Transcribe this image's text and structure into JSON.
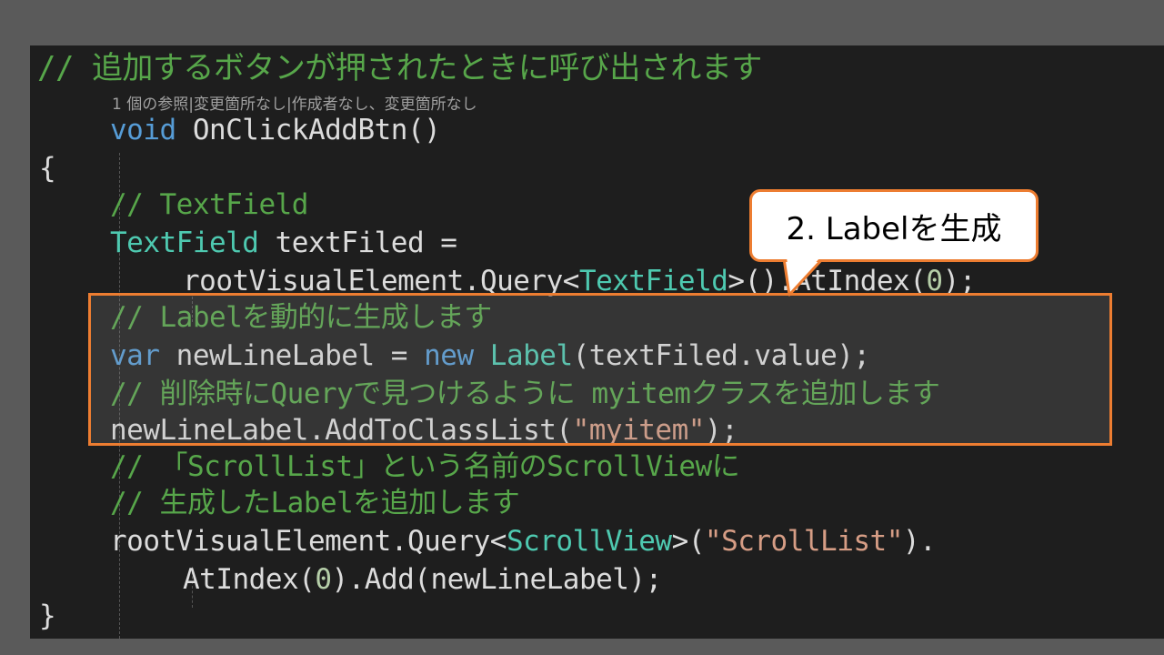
{
  "code": {
    "header_comment": "// 追加するボタンが押されたときに呼び出されます",
    "codelens": "1 個の参照|変更箇所なし|作成者なし、変更箇所なし",
    "lines": {
      "l1_kw": "void",
      "l1_rest": " OnClickAddBtn()",
      "l2": "{",
      "l3": "// TextField",
      "l4_type": "TextField",
      "l4_rest": " textFiled =",
      "l5_a": "rootVisualElement.Query<",
      "l5_type": "TextField",
      "l5_b": ">().AtIndex(",
      "l5_num": "0",
      "l5_c": ");",
      "l6": "// Labelを動的に生成します",
      "l7_kw1": "var",
      "l7_a": " newLineLabel = ",
      "l7_kw2": "new",
      "l7_sp": " ",
      "l7_type": "Label",
      "l7_b": "(textFiled.value);",
      "l8": "// 削除時にQueryで見つけるように myitemクラスを追加します",
      "l9_a": "newLineLabel.AddToClassList(",
      "l9_str": "\"myitem\"",
      "l9_b": ");",
      "l10": "// 「ScrollList」という名前のScrollViewに",
      "l11": "// 生成したLabelを追加します",
      "l12_a": "rootVisualElement.Query<",
      "l12_type": "ScrollView",
      "l12_b": ">(",
      "l12_str": "\"ScrollList\"",
      "l12_c": ").",
      "l13_a": "AtIndex(",
      "l13_num": "0",
      "l13_b": ").Add(newLineLabel);",
      "l14": "}"
    }
  },
  "callout": {
    "text": "2. Labelを生成"
  },
  "colors": {
    "background": "#5a5a5a",
    "editor": "#1e1e1e",
    "comment": "#57a64a",
    "keyword": "#569cd6",
    "type": "#4ec9b0",
    "accent": "#ed7d31"
  }
}
